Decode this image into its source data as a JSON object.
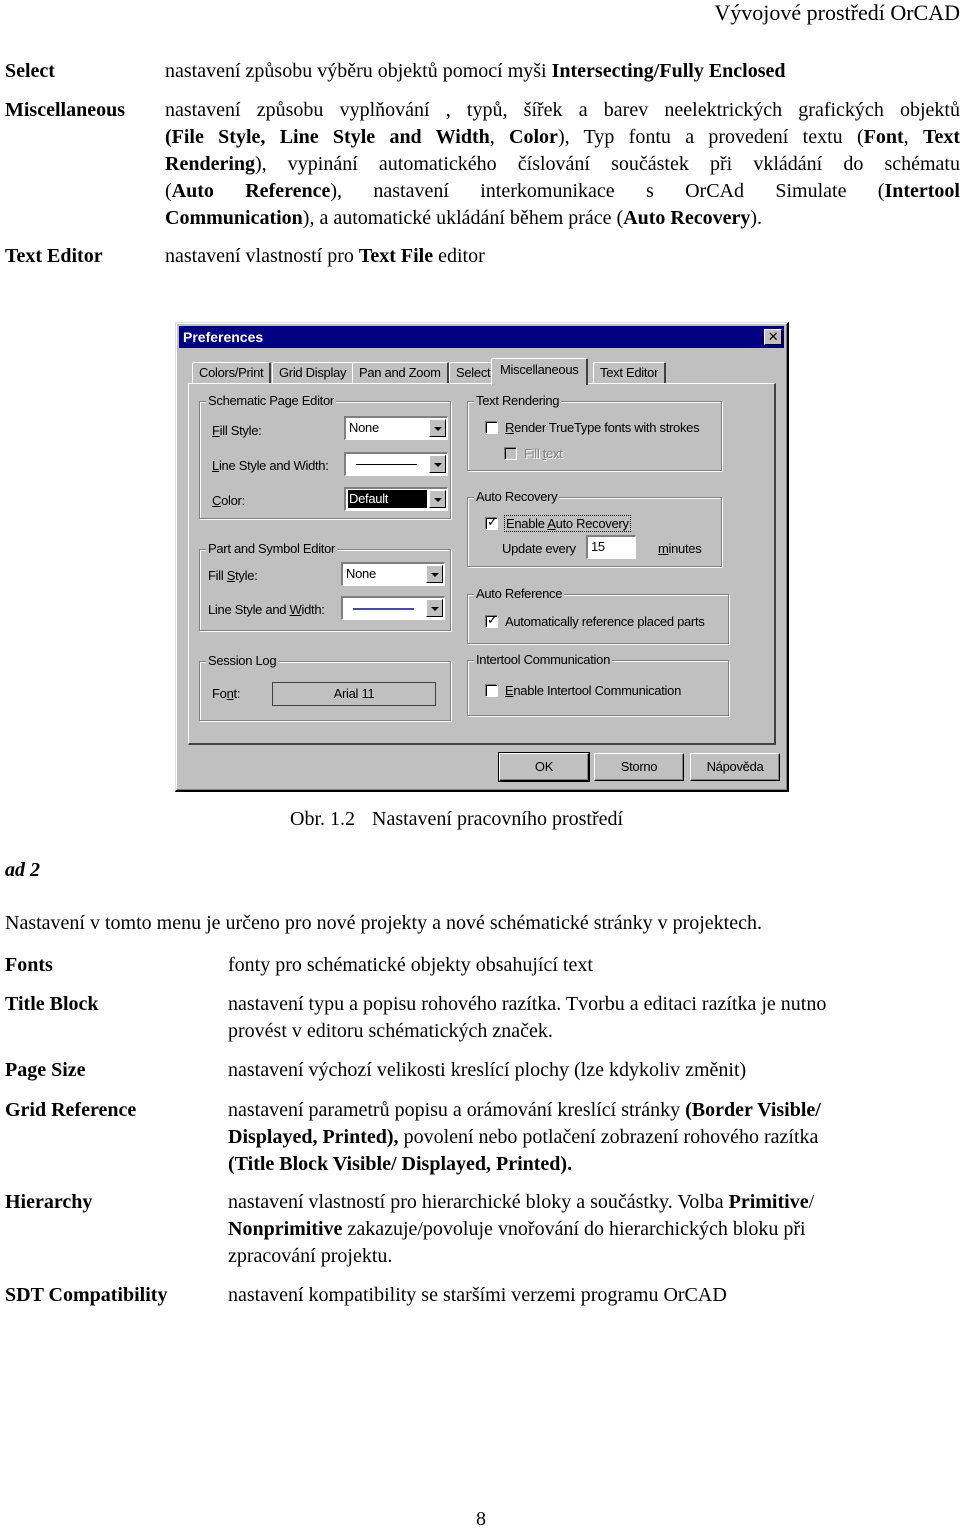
{
  "page_header": "Vývojové prostředí OrCAD",
  "top_definitions": [
    {
      "term": "Select",
      "lines": [
        [
          {
            "t": "nastavení způsobu výběru objektů pomocí myši "
          },
          {
            "t": "Intersecting/Fully Enclosed",
            "b": true
          }
        ]
      ]
    },
    {
      "term": "Miscellaneous",
      "lines": [
        [
          {
            "t": "nastavení způsobu vyplňování , typů, šířek a barev neelektrických grafických objektů"
          }
        ],
        [
          {
            "t": "(File Style, Line Style and Width",
            "b": true
          },
          {
            "t": ", "
          },
          {
            "t": "Color",
            "b": true
          },
          {
            "t": "), Typ fontu a provedení textu ("
          },
          {
            "t": "Font",
            "b": true
          },
          {
            "t": ", "
          },
          {
            "t": "Text",
            "b": true
          }
        ],
        [
          {
            "t": "Rendering",
            "b": true
          },
          {
            "t": "), vypinání automatického číslování součástek při vkládání do schématu"
          }
        ],
        [
          {
            "t": "("
          },
          {
            "t": "Auto Reference",
            "b": true
          },
          {
            "t": "), nastavení interkomunikace s OrCAd Simulate ("
          },
          {
            "t": "Intertool",
            "b": true
          }
        ],
        [
          {
            "t": "Communication",
            "b": true
          },
          {
            "t": "), a automatické ukládání během práce ("
          },
          {
            "t": "Auto Recovery",
            "b": true
          },
          {
            "t": ")."
          }
        ]
      ]
    },
    {
      "term": "Text Editor",
      "lines": [
        [
          {
            "t": "nastavení vlastností pro "
          },
          {
            "t": "Text File",
            "b": true
          },
          {
            "t": " editor"
          }
        ]
      ]
    }
  ],
  "dialog": {
    "title": "Preferences",
    "close_label": "✕",
    "tabs": [
      {
        "label": "Colors/Print",
        "active": false
      },
      {
        "label": "Grid Display",
        "active": false
      },
      {
        "label": "Pan and Zoom",
        "active": false
      },
      {
        "label": "Select",
        "active": false
      },
      {
        "label": "Miscellaneous",
        "active": true
      },
      {
        "label": "Text Editor",
        "active": false
      }
    ],
    "schematic_page_editor": {
      "label": "Schematic Page Editor",
      "fill_style_label_u": "F",
      "fill_style_label_rest": "ill Style:",
      "fill_style_value": "None",
      "line_style_label_u": "L",
      "line_style_label_rest": "ine Style and Width:",
      "line_style_value": "solid-thin-black",
      "color_label_u": "C",
      "color_label_rest": "olor:",
      "color_value": "Default"
    },
    "part_symbol_editor": {
      "label": "Part and Symbol Editor",
      "fill_style_label_pre": "Fill ",
      "fill_style_label_u": "S",
      "fill_style_label_rest": "tyle:",
      "fill_style_value": "None",
      "line_style_label_pre": "Line Style and ",
      "line_style_label_u": "W",
      "line_style_label_rest": "idth:",
      "line_style_value": "solid-thin-blue"
    },
    "session_log": {
      "label": "Session Log",
      "font_label_pre": "Fo",
      "font_label_u": "n",
      "font_label_rest": "t:",
      "font_value": "Arial 11"
    },
    "text_rendering": {
      "label": "Text Rendering",
      "render_truetype_u": "R",
      "render_truetype_rest": "ender TrueType fonts with strokes",
      "render_truetype_checked": false,
      "fill_text_pre": "Fill ",
      "fill_text_u": "t",
      "fill_text_rest": "ext",
      "fill_text_checked": false,
      "fill_text_enabled": false
    },
    "auto_recovery": {
      "label": "Auto Recovery",
      "enable_pre": "Enable ",
      "enable_u": "A",
      "enable_rest": "uto Recovery",
      "enable_checked": true,
      "update_every_label": "Update every",
      "update_every_value": "15",
      "minutes_u": "m",
      "minutes_rest": "inutes"
    },
    "auto_reference": {
      "label": "Auto Reference",
      "auto_ref_label": "Automatically reference placed parts",
      "auto_ref_checked": true
    },
    "intertool": {
      "label": "Intertool Communication",
      "enable_u": "E",
      "enable_rest": "nable Intertool Communication",
      "enable_checked": false
    },
    "buttons": {
      "ok": "OK",
      "cancel": "Storno",
      "help": "Nápověda"
    }
  },
  "caption": {
    "number": "Obr. 1.2",
    "text": "Nastavení pracovního prostředí"
  },
  "ad_heading": "ad 2",
  "intro": "Nastavení v tomto menu je určeno pro nové projekty a nové schématické stránky v projektech.",
  "bottom_definitions": [
    {
      "term": "Fonts",
      "lines": [
        [
          {
            "t": "fonty pro schématické objekty obsahující text"
          }
        ]
      ]
    },
    {
      "term": "Title Block",
      "lines": [
        [
          {
            "t": "nastavení typu a popisu rohového razítka. Tvorbu a editaci razítka je nutno"
          }
        ],
        [
          {
            "t": "provést v editoru schématických značek."
          }
        ]
      ]
    },
    {
      "term": "Page Size",
      "lines": [
        [
          {
            "t": "nastavení výchozí velikosti  kreslící plochy (lze kdykoliv změnit)"
          }
        ]
      ]
    },
    {
      "term": "Grid Reference",
      "lines": [
        [
          {
            "t": "nastavení parametrů popisu a orámování kreslící stránky "
          },
          {
            "t": "(Border Visible/",
            "b": true
          }
        ],
        [
          {
            "t": "Displayed, Printed),",
            "b": true
          },
          {
            "t": " povolení nebo potlačení zobrazení rohového razítka"
          }
        ],
        [
          {
            "t": "(Title Block Visible/ Displayed, Printed).",
            "b": true
          }
        ]
      ]
    },
    {
      "term": "Hierarchy",
      "lines": [
        [
          {
            "t": "nastavení vlastností pro hierarchické bloky a součástky. Volba "
          },
          {
            "t": "Primitive",
            "b": true
          },
          {
            "t": "/"
          }
        ],
        [
          {
            "t": "Nonprimitive",
            "b": true
          },
          {
            "t": " zakazuje/povoluje vnořování do hierarchických bloku při"
          }
        ],
        [
          {
            "t": "zpracování projektu."
          }
        ]
      ]
    },
    {
      "term": "SDT Compatibility",
      "lines": [
        [
          {
            "t": "nastavení kompatibility se staršími verzemi programu OrCAD"
          }
        ]
      ]
    }
  ],
  "page_number": "8"
}
